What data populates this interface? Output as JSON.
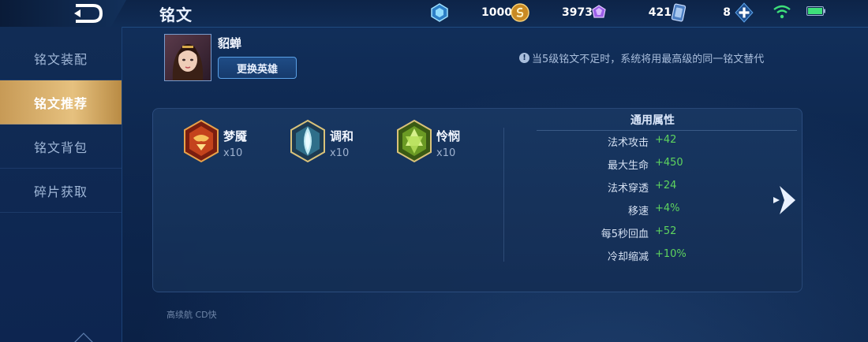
{
  "header": {
    "title": "铭文",
    "resources": [
      {
        "name": "diamond",
        "value": "1000",
        "color": "#6ec8f5"
      },
      {
        "name": "gold-coin",
        "value": "3973",
        "color": "#e7b24a"
      },
      {
        "name": "purple-gem",
        "value": "421",
        "color": "#b585f2"
      },
      {
        "name": "card",
        "value": "8",
        "color": "#8fb4e8"
      }
    ],
    "wifi_color": "#3ee07a",
    "battery_color": "#3ee07a"
  },
  "sidebar": {
    "items": [
      {
        "label": "铭文装配",
        "active": false
      },
      {
        "label": "铭文推荐",
        "active": true
      },
      {
        "label": "铭文背包",
        "active": false
      },
      {
        "label": "碎片获取",
        "active": false
      }
    ]
  },
  "hero": {
    "name": "貂蝉",
    "change_button": "更换英雄"
  },
  "notice": "当5级铭文不足时，系统将用最高级的同一铭文替代",
  "runes": [
    {
      "name": "梦魇",
      "count": "x10",
      "color": "red"
    },
    {
      "name": "调和",
      "count": "x10",
      "color": "blue"
    },
    {
      "name": "怜悯",
      "count": "x10",
      "color": "green"
    }
  ],
  "attributes": {
    "title": "通用属性",
    "rows": [
      {
        "label": "法术攻击",
        "value": "+42"
      },
      {
        "label": "最大生命",
        "value": "+450"
      },
      {
        "label": "法术穿透",
        "value": "+24"
      },
      {
        "label": "移速",
        "value": "+4%"
      },
      {
        "label": "每5秒回血",
        "value": "+52"
      },
      {
        "label": "冷却缩减",
        "value": "+10%"
      }
    ]
  },
  "footer": "高续航 CD快"
}
